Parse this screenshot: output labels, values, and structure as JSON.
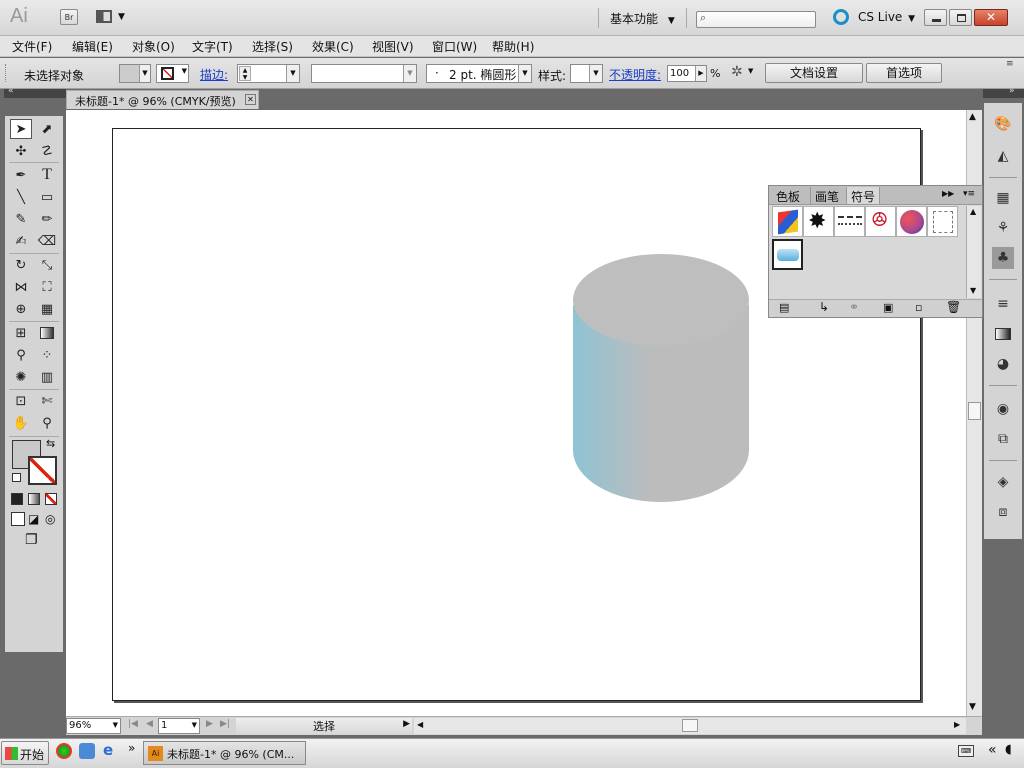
{
  "app": {
    "logo": "Ai",
    "bridge_label": "Br",
    "workspace": "基本功能",
    "cslive": "CS Live"
  },
  "menu": [
    "文件(F)",
    "编辑(E)",
    "对象(O)",
    "文字(T)",
    "选择(S)",
    "效果(C)",
    "视图(V)",
    "窗口(W)",
    "帮助(H)"
  ],
  "control": {
    "selection_status": "未选择对象",
    "stroke_label": "描边:",
    "brush_label": "2 pt. 椭圆形",
    "style_label": "样式:",
    "opacity_label": "不透明度:",
    "opacity_value": "100",
    "opacity_unit": "%",
    "doc_settings": "文档设置",
    "preferences": "首选项"
  },
  "document": {
    "tab_title": "未标题-1* @ 96% (CMYK/预览)"
  },
  "panel": {
    "tabs": [
      "色板",
      "画笔",
      "符号"
    ],
    "active_tab": "符号"
  },
  "statusbar": {
    "zoom": "96%",
    "page": "1",
    "tool": "选择"
  },
  "taskbar": {
    "start": "开始",
    "task": "未标题-1* @ 96% (CM..."
  },
  "colors": {
    "cylinder_side_left": "#8fc3d3",
    "cylinder_side_mid": "#bcbcbc",
    "cylinder_top": "#bebebe",
    "canvas_bg": "#6a6a6a"
  }
}
